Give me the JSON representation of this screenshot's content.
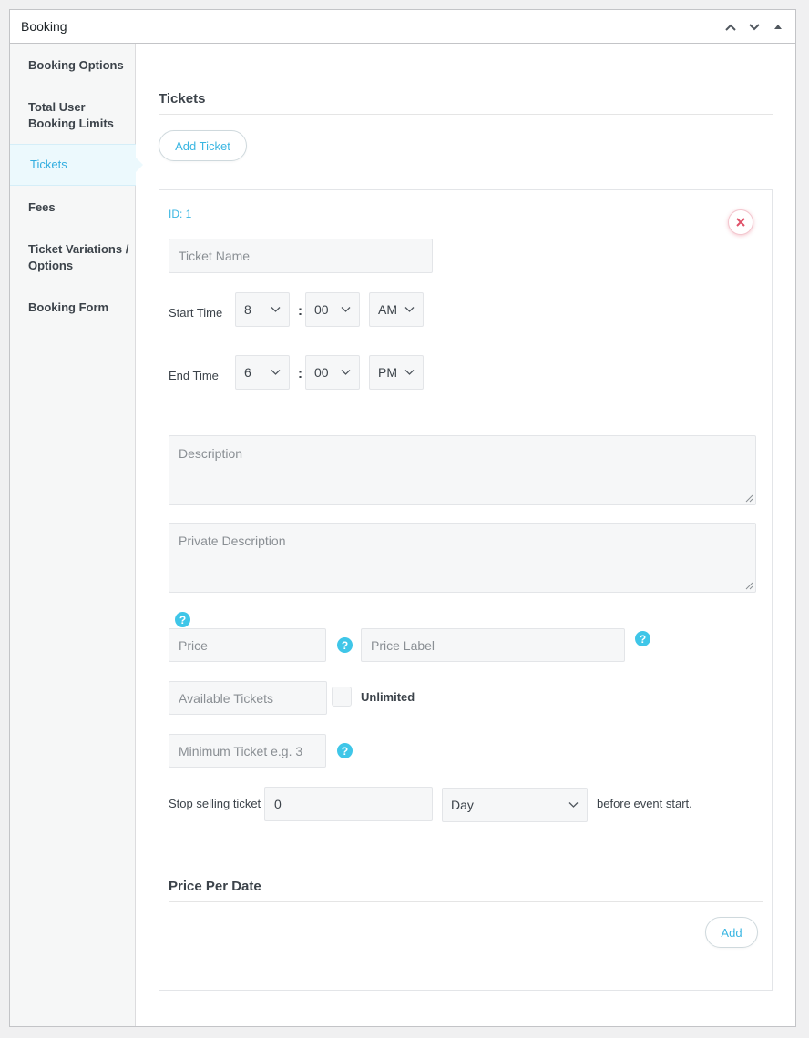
{
  "panel": {
    "title": "Booking",
    "actions": [
      "chevron-up-icon",
      "chevron-down-icon",
      "triangle-up-icon"
    ]
  },
  "sidebar": {
    "items": [
      {
        "label": "Booking Options"
      },
      {
        "label": "Total User Booking Limits"
      },
      {
        "label": "Tickets"
      },
      {
        "label": "Fees"
      },
      {
        "label": "Ticket Variations / Options"
      },
      {
        "label": "Booking Form"
      }
    ],
    "active_index": 2
  },
  "tickets_section": {
    "title": "Tickets",
    "add_ticket_label": "Add Ticket"
  },
  "ticket": {
    "id_label": "ID: 1",
    "name_placeholder": "Ticket Name",
    "start_time": {
      "label": "Start Time",
      "hour": "8",
      "separator": ":",
      "minute": "00",
      "ampm": "AM"
    },
    "end_time": {
      "label": "End Time",
      "hour": "6",
      "separator": ":",
      "minute": "00",
      "ampm": "PM"
    },
    "description_placeholder": "Description",
    "private_description_placeholder": "Private Description",
    "price_placeholder": "Price",
    "price_label_placeholder": "Price Label",
    "available_tickets_placeholder": "Available Tickets",
    "unlimited_label": "Unlimited",
    "minimum_ticket_placeholder": "Minimum Ticket e.g. 3",
    "stop_selling": {
      "label": "Stop selling ticket",
      "value": "0",
      "unit": "Day",
      "suffix": "before event start."
    },
    "help_glyph": "?"
  },
  "price_per_date": {
    "title": "Price Per Date",
    "add_label": "Add"
  },
  "colors": {
    "accent": "#3ab6e2",
    "help": "#3fc6e8",
    "remove": "#e05168"
  }
}
